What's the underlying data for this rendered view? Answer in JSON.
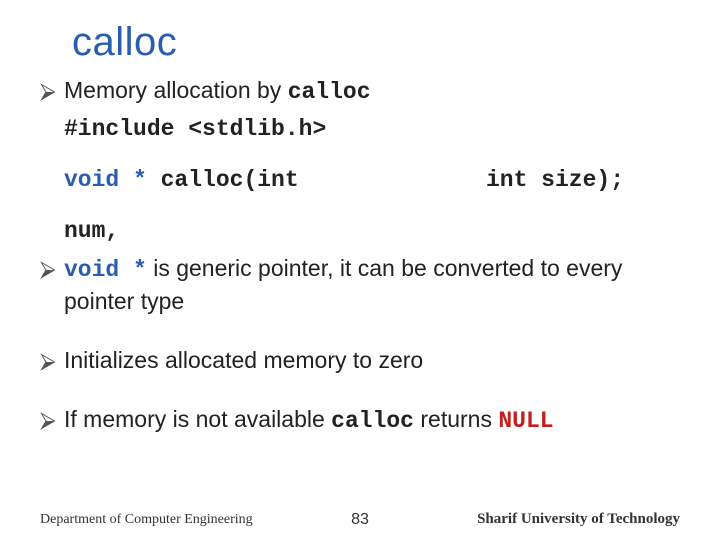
{
  "title": "calloc",
  "bullets": {
    "b1_text": "Memory allocation by ",
    "b1_code": "calloc",
    "include_line": "#include <stdlib.h>",
    "proto_void": "void *",
    "proto_mid": " calloc(int",
    "proto_end": "int size);",
    "num_line": "num,",
    "b2_code": "void *",
    "b2_text": " is generic pointer, it can be converted to  every pointer type",
    "b3_text": "Initializes allocated memory to zero",
    "b4_text1": "If memory is not available ",
    "b4_code": "calloc",
    "b4_text2": " returns ",
    "b4_null": "NULL"
  },
  "footer": {
    "left": "Department of Computer Engineering",
    "center": "83",
    "right": "Sharif University of Technology"
  },
  "bullet_glyph": "⮚"
}
